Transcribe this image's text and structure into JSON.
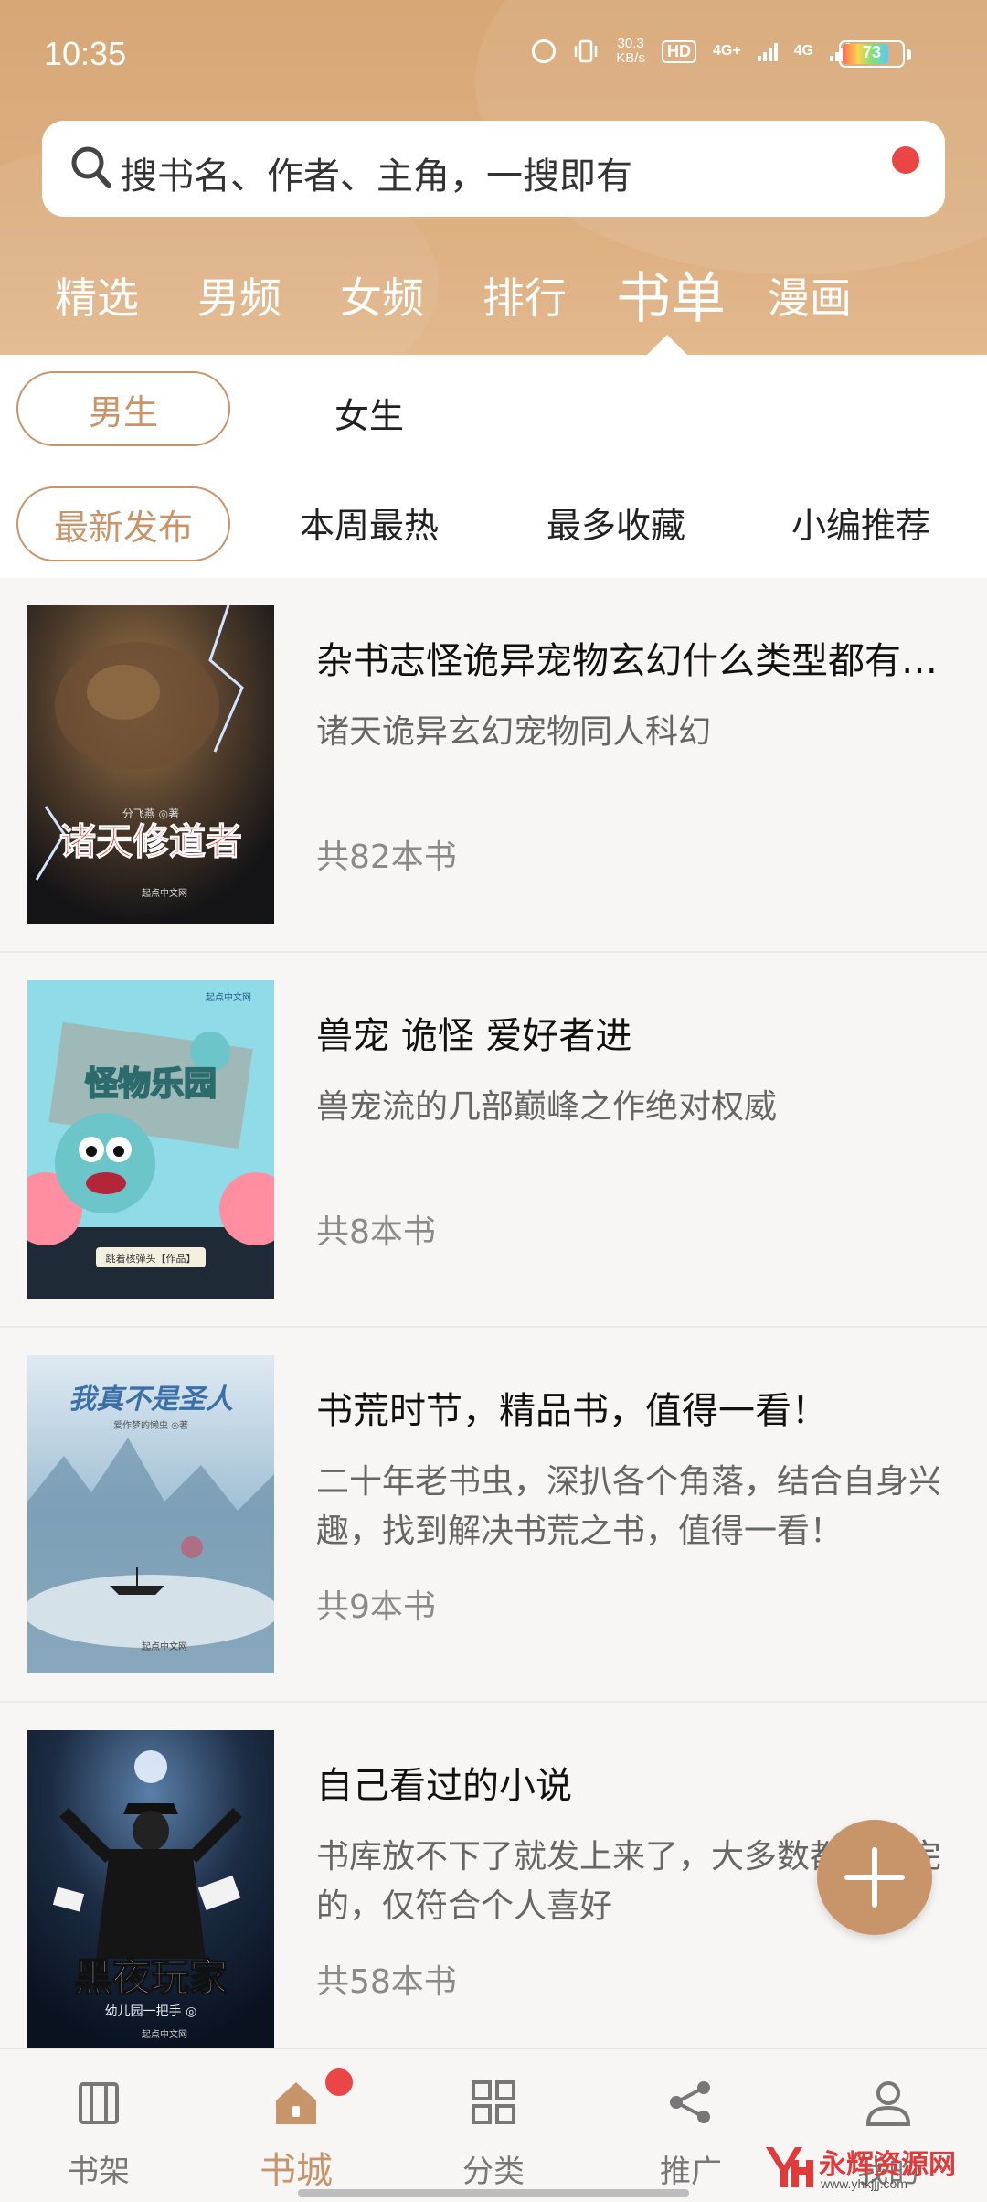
{
  "status_bar": {
    "time": "10:35",
    "speed": "30.3",
    "speed_unit": "KB/s",
    "hd": "HD",
    "net1": "4G+",
    "net2": "4G",
    "battery": "73"
  },
  "search": {
    "placeholder": "搜书名、作者、主角，一搜即有",
    "icon": "search-icon"
  },
  "top_tabs": [
    "精选",
    "男频",
    "女频",
    "排行",
    "书单",
    "漫画"
  ],
  "active_top_tab": "书单",
  "gender_filter": {
    "options": [
      "男生",
      "女生"
    ],
    "selected": "男生"
  },
  "sort_filter": {
    "options": [
      "最新发布",
      "本周最热",
      "最多收藏",
      "小编推荐"
    ],
    "selected": "最新发布"
  },
  "booklists": [
    {
      "title": "杂书志怪诡异宠物玄幻什么类型都有…",
      "desc": "诸天诡异玄幻宠物同人科幻",
      "count": "共82本书",
      "cover_title": "诸天修道者",
      "cover_author": "分飞燕 ◎著",
      "cover_publisher": "起点中文网"
    },
    {
      "title": "兽宠 诡怪 爱好者进",
      "desc": "兽宠流的几部巅峰之作绝对权威",
      "count": "共8本书",
      "cover_title": "怪物乐园",
      "cover_author": "跳着核弹头【作品】",
      "cover_publisher": "起点中文网"
    },
    {
      "title": "书荒时节，精品书，值得一看！",
      "desc": "二十年老书虫，深扒各个角落，结合自身兴趣，找到解决书荒之书，值得一看！",
      "count": "共9本书",
      "cover_title": "我真不是圣人",
      "cover_author": "爱作梦的懒虫 ◎著",
      "cover_publisher": "起点中文网"
    },
    {
      "title": "自己看过的小说",
      "desc": "书库放不下了就发上来了，大多数都是看完的，仅符合个人喜好",
      "count": "共58本书",
      "cover_title": "黑夜玩家",
      "cover_author": "幼儿园一把手 ◎",
      "cover_publisher": "起点中文网"
    }
  ],
  "bottom_nav": [
    {
      "label": "书架",
      "icon": "bookshelf-icon"
    },
    {
      "label": "书城",
      "icon": "home-icon"
    },
    {
      "label": "分类",
      "icon": "grid-icon"
    },
    {
      "label": "推广",
      "icon": "share-icon"
    },
    {
      "label": "我的",
      "icon": "user-icon"
    }
  ],
  "active_bottom_nav": "书城",
  "watermark": {
    "text": "永辉资源网",
    "sub": "www.yhkjjj.com"
  },
  "colors": {
    "accent": "#c8956a",
    "header": "#d9aa7b",
    "badge": "#ea4646"
  }
}
